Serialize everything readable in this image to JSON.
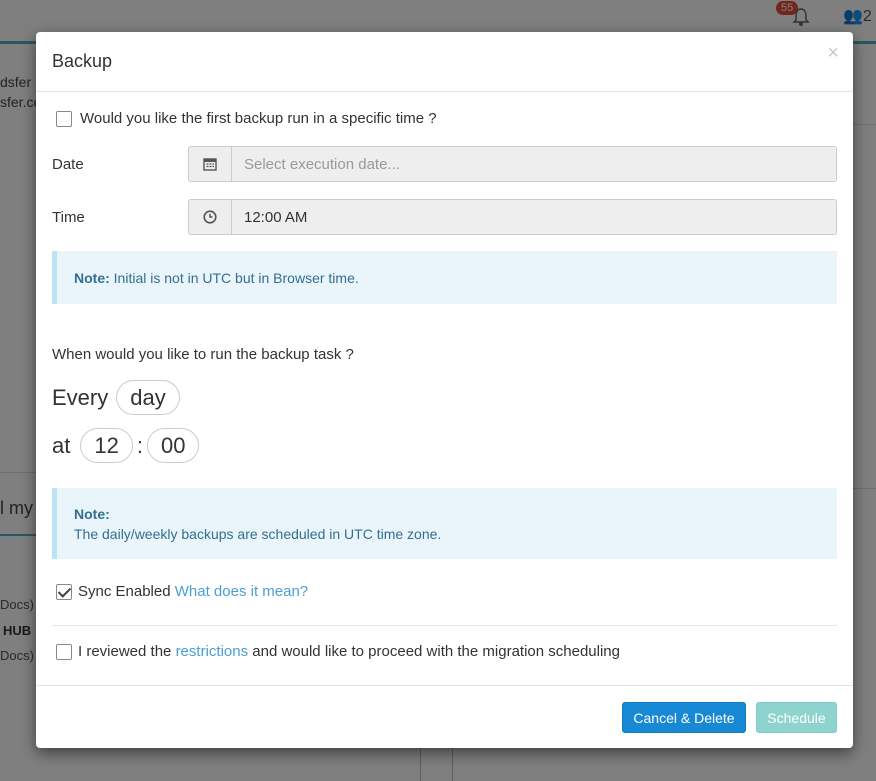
{
  "background": {
    "badge_count": "55",
    "users_count": "2",
    "left_text_1": "dsfer",
    "left_text_2": "sfer.co",
    "left_text_3": "l my",
    "docs_1": "Docs)",
    "hub": "HUB",
    "docs_2": "Docs)"
  },
  "modal": {
    "title": "Backup",
    "close_label": "×",
    "first_run_label": "Would you like the first backup run in a specific time ?",
    "date": {
      "label": "Date",
      "placeholder": "Select execution date...",
      "icon": "calendar-icon"
    },
    "time": {
      "label": "Time",
      "value": "12:00 AM",
      "icon": "clock-icon"
    },
    "note1": {
      "prefix": "Note:",
      "text": "Initial is not in UTC but in Browser time."
    },
    "question": "When would you like to run the backup task ?",
    "cron": {
      "every_label": "Every",
      "period": "day",
      "at_label": "at",
      "hour": "12",
      "separator": ":",
      "minute": "00"
    },
    "note2": {
      "prefix": "Note:",
      "text": "The daily/weekly backups are scheduled in UTC time zone."
    },
    "sync": {
      "checked": true,
      "label": "Sync Enabled",
      "link": "What does it mean?"
    },
    "review": {
      "checked": false,
      "before": "I reviewed the",
      "link": "restrictions",
      "after": "and would like to proceed with the migration scheduling"
    },
    "buttons": {
      "cancel": "Cancel & Delete",
      "schedule": "Schedule"
    }
  },
  "colors": {
    "primary": "#1789d4",
    "schedule_disabled": "#8fd3cf",
    "note_bg": "#eaf4fb",
    "note_text": "#31708f",
    "link": "#4a9fd4"
  }
}
